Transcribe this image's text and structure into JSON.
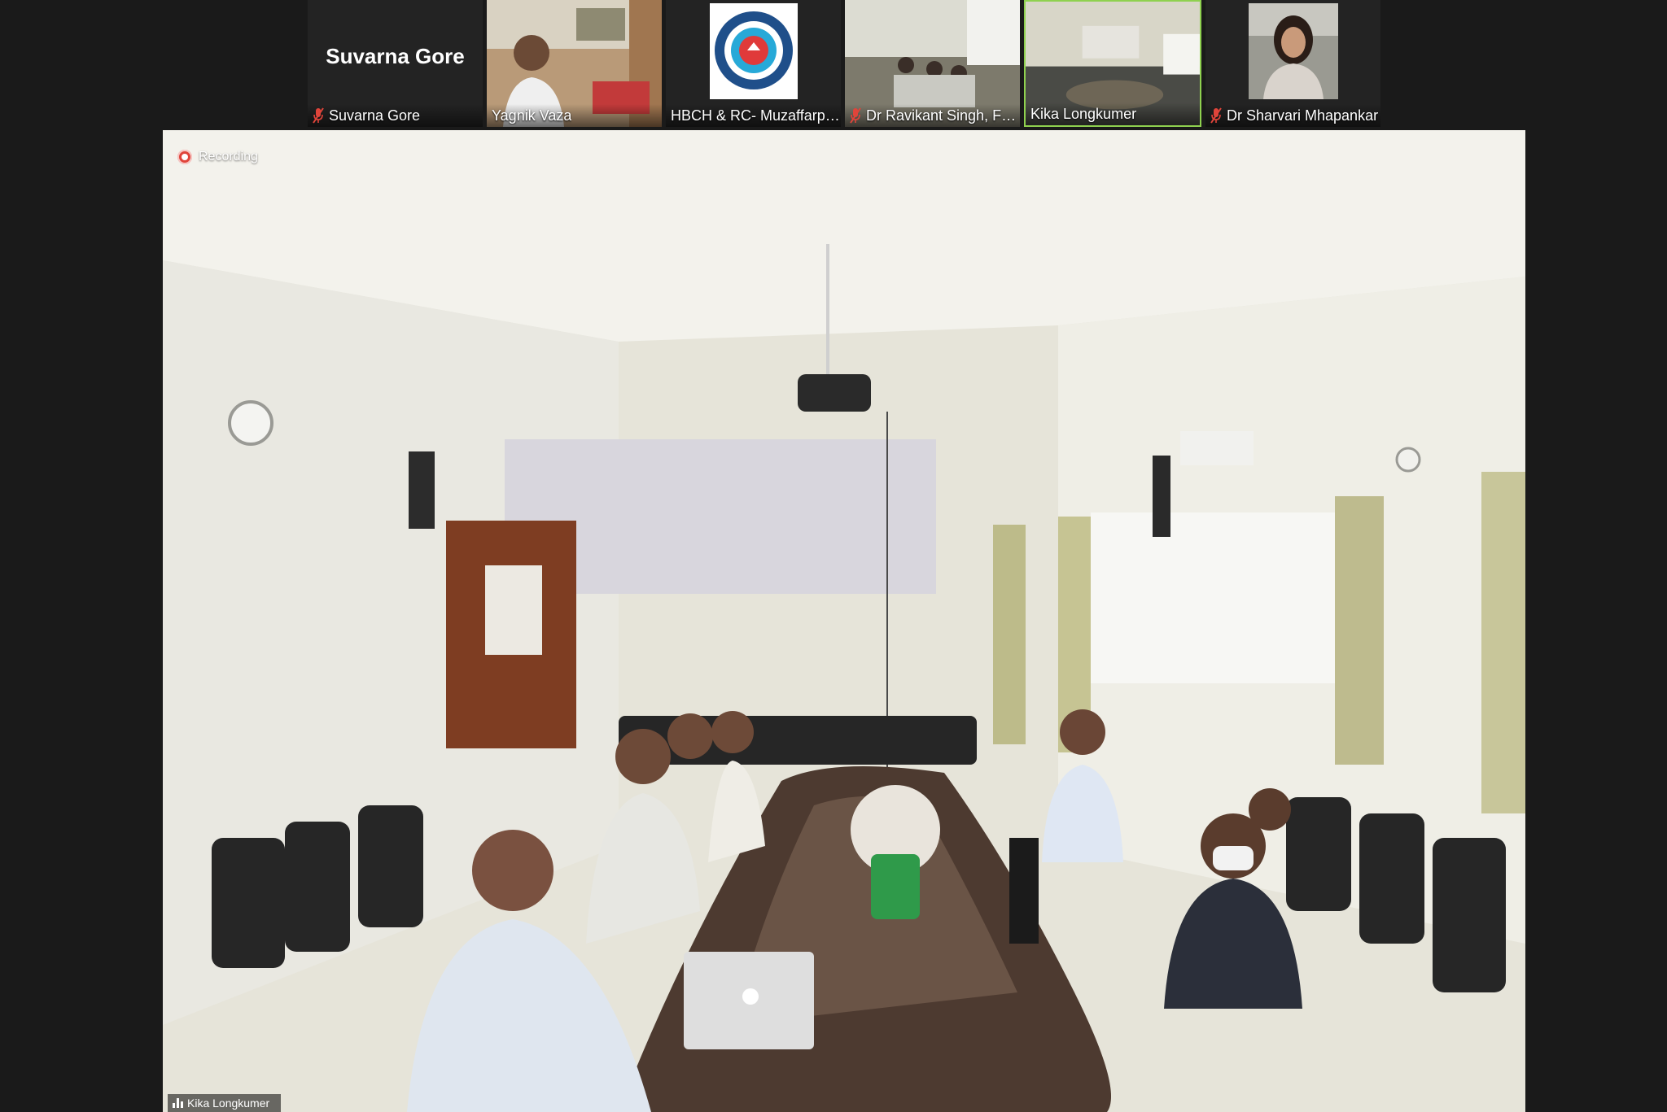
{
  "meeting": {
    "participants": [
      {
        "name": "Suvarna Gore",
        "big_name": "Suvarna Gore",
        "muted": true,
        "video": false
      },
      {
        "name": "Yagnik Vaza",
        "muted": false,
        "video": true
      },
      {
        "name": "HBCH & RC- Muzaffarpur ...",
        "muted": false,
        "video": true
      },
      {
        "name": "Dr Ravikant Singh, Fou...",
        "muted": true,
        "video": true
      },
      {
        "name": "Kika Longkumer",
        "muted": false,
        "video": true,
        "active_speaker": true
      },
      {
        "name": "Dr Sharvari Mhapankar",
        "muted": true,
        "video": true
      }
    ],
    "recording_label": "Recording",
    "main_speaker_label": "Kika Longkumer"
  },
  "colors": {
    "active_border": "#8fd14f",
    "muted_icon": "#e0443a",
    "recording": "#e0443a",
    "background": "#1a1a1a"
  },
  "icons": {
    "muted": "mic-muted-icon",
    "recording": "record-dot-icon",
    "speaking": "audio-bars-icon"
  }
}
